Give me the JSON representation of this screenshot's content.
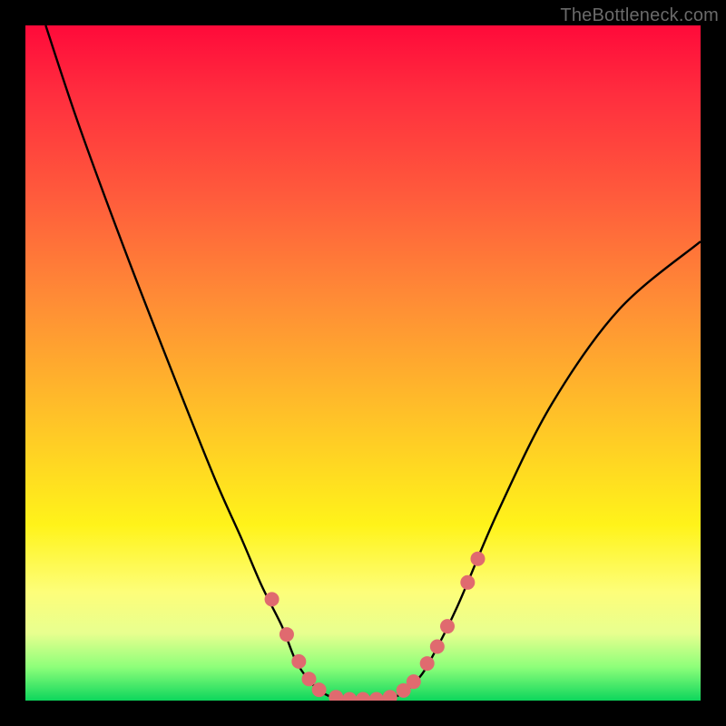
{
  "watermark": "TheBottleneck.com",
  "chart_data": {
    "type": "line",
    "title": "",
    "xlabel": "",
    "ylabel": "",
    "xlim": [
      0,
      100
    ],
    "ylim": [
      0,
      100
    ],
    "series": [
      {
        "name": "curve",
        "x": [
          3,
          8,
          15,
          22,
          28,
          32,
          35,
          38,
          40,
          42,
          44,
          46,
          48,
          50,
          52,
          54,
          56,
          58,
          60,
          64,
          70,
          78,
          88,
          100
        ],
        "y": [
          100,
          85,
          66,
          48,
          33,
          24,
          17,
          11,
          6,
          3,
          1.2,
          0.3,
          0,
          0,
          0,
          0.3,
          1.2,
          3,
          6,
          14,
          28,
          44,
          58,
          68
        ]
      }
    ],
    "markers": [
      {
        "x": 36.5,
        "y": 15.0
      },
      {
        "x": 38.7,
        "y": 9.8
      },
      {
        "x": 40.5,
        "y": 5.8
      },
      {
        "x": 42.0,
        "y": 3.2
      },
      {
        "x": 43.5,
        "y": 1.6
      },
      {
        "x": 46.0,
        "y": 0.5
      },
      {
        "x": 48.0,
        "y": 0.2
      },
      {
        "x": 50.0,
        "y": 0.2
      },
      {
        "x": 52.0,
        "y": 0.2
      },
      {
        "x": 54.0,
        "y": 0.5
      },
      {
        "x": 56.0,
        "y": 1.5
      },
      {
        "x": 57.5,
        "y": 2.8
      },
      {
        "x": 59.5,
        "y": 5.5
      },
      {
        "x": 61.0,
        "y": 8.0
      },
      {
        "x": 62.5,
        "y": 11.0
      },
      {
        "x": 65.5,
        "y": 17.5
      },
      {
        "x": 67.0,
        "y": 21.0
      }
    ],
    "marker_color": "#e06a6f",
    "marker_radius": 8,
    "curve_color": "#000000",
    "curve_width": 2.4
  }
}
